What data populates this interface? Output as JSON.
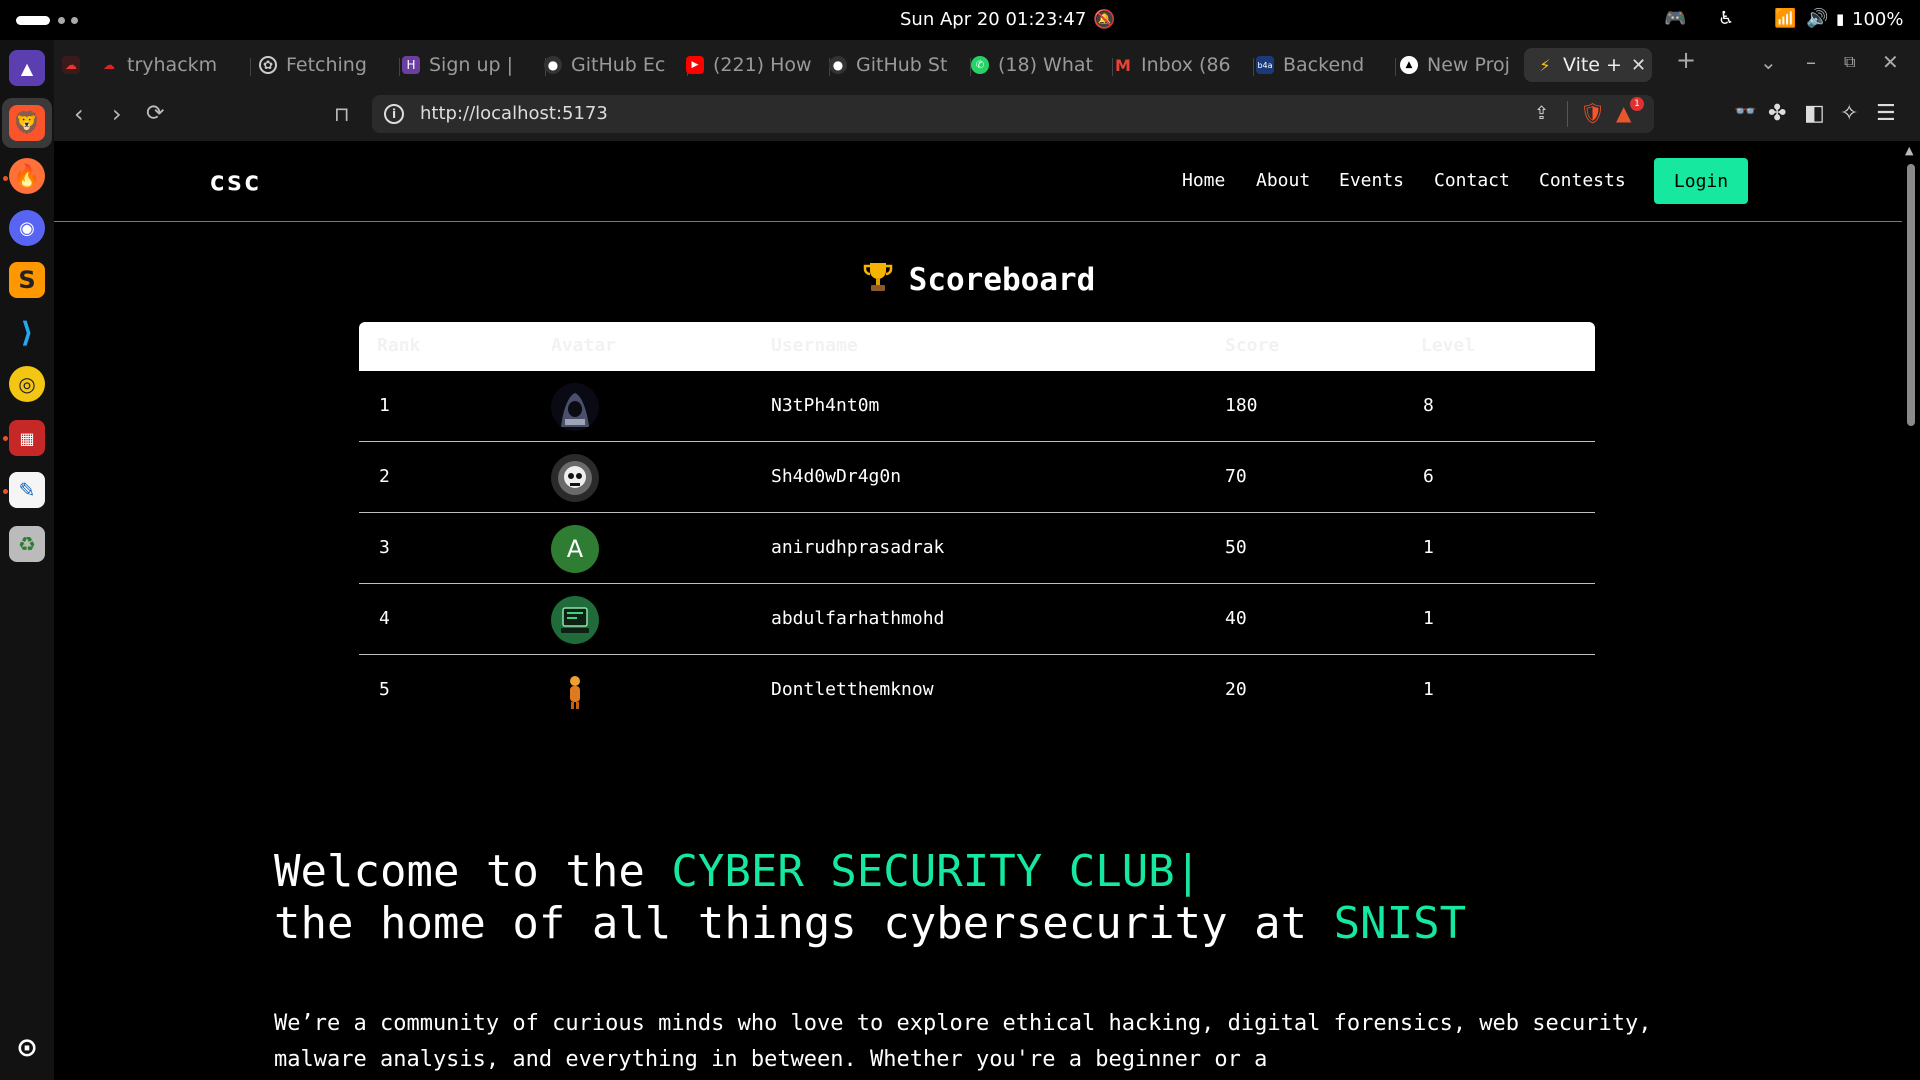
{
  "system": {
    "clock": "Sun Apr 20  01:23:47",
    "battery": "100%"
  },
  "browser": {
    "tabs": [
      {
        "label": "tryhackm",
        "icon": "tryhackme-icon",
        "color": "#c00"
      },
      {
        "label": "Fetching",
        "icon": "openai-icon",
        "color": "#444"
      },
      {
        "label": "Sign up |",
        "icon": "h-icon",
        "color": "#6b3fa0"
      },
      {
        "label": "GitHub Ec",
        "icon": "github-icon",
        "color": "#333"
      },
      {
        "label": "(221) How",
        "icon": "youtube-icon",
        "color": "#f00"
      },
      {
        "label": "GitHub St",
        "icon": "github-icon",
        "color": "#333"
      },
      {
        "label": "(18) What",
        "icon": "whatsapp-icon",
        "color": "#25d366"
      },
      {
        "label": "Inbox (86",
        "icon": "gmail-icon",
        "color": "#ea4335"
      },
      {
        "label": "Backend",
        "icon": "b4a-icon",
        "color": "#1a73e8"
      },
      {
        "label": "New Proj",
        "icon": "vercel-icon",
        "color": "#000"
      },
      {
        "label": "Vite +",
        "icon": "vite-icon",
        "color": "#8f68ff",
        "active": true
      }
    ],
    "url": "http://localhost:5173",
    "notification_count": "1"
  },
  "site": {
    "brand": "csc",
    "nav": [
      "Home",
      "About",
      "Events",
      "Contact",
      "Contests"
    ],
    "login_label": "Login"
  },
  "scoreboard": {
    "title": "Scoreboard",
    "columns": [
      "Rank",
      "Avatar",
      "Username",
      "Score",
      "Level"
    ],
    "rows": [
      {
        "rank": "1",
        "avatar": "hooded-hacker-avatar",
        "username": "N3tPh4nt0m",
        "score": "180",
        "level": "8"
      },
      {
        "rank": "2",
        "avatar": "skull-avatar",
        "username": "Sh4d0wDr4g0n",
        "score": "70",
        "level": "6"
      },
      {
        "rank": "3",
        "avatar": "letter-avatar",
        "avatar_letter": "A",
        "username": "anirudhprasadrak",
        "score": "50",
        "level": "1"
      },
      {
        "rank": "4",
        "avatar": "computer-avatar",
        "username": "abdulfarhathmohd",
        "score": "40",
        "level": "1"
      },
      {
        "rank": "5",
        "avatar": "figure-avatar",
        "username": "Dontletthemknow",
        "score": "20",
        "level": "1"
      }
    ]
  },
  "hero": {
    "line1_prefix": "Welcome to the ",
    "line1_accent": "CYBER SECURITY CLUB|",
    "line2_prefix": "the home of all things cybersecurity at ",
    "line2_accent": "SNIST",
    "description": "We’re a community of curious minds who love to explore ethical hacking, digital forensics, web security, malware analysis, and everything in between. Whether you're a beginner or a"
  },
  "colors": {
    "accent": "#16e8a0",
    "page_bg": "#000000"
  }
}
